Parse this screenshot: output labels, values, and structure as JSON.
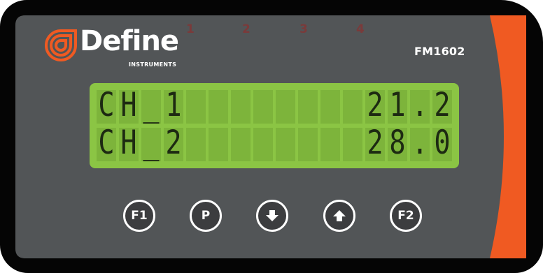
{
  "brand": {
    "name": "Define",
    "subtitle": "INSTRUMENTS",
    "model": "FM1602",
    "accent_color": "#f05a22",
    "logo_icon": "define-logo-icon"
  },
  "indicators": [
    "1",
    "2",
    "3",
    "4"
  ],
  "display": {
    "background_color": "#8bc544",
    "rows": [
      {
        "label": "CH_1",
        "value": "21.2"
      },
      {
        "label": "CH_2",
        "value": "28.0"
      }
    ]
  },
  "buttons": [
    {
      "label": "F1"
    },
    {
      "label": "P"
    },
    {
      "icon": "arrow-down-icon"
    },
    {
      "icon": "arrow-up-icon"
    },
    {
      "label": "F2"
    }
  ]
}
